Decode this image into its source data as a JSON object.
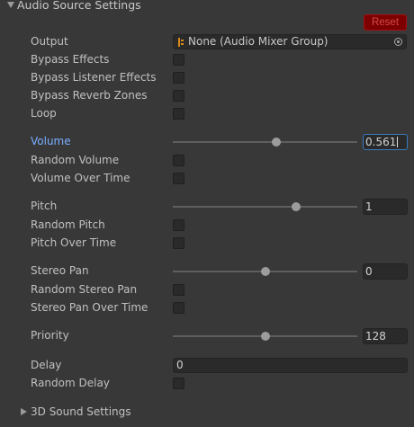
{
  "header": {
    "title": "Audio Source Settings",
    "reset_label": "Reset"
  },
  "output": {
    "label": "Output",
    "value": "None (Audio Mixer Group)"
  },
  "checkboxes_top": [
    {
      "label": "Bypass Effects",
      "checked": false
    },
    {
      "label": "Bypass Listener Effects",
      "checked": false
    },
    {
      "label": "Bypass Reverb Zones",
      "checked": false
    },
    {
      "label": "Loop",
      "checked": false
    }
  ],
  "volume": {
    "label": "Volume",
    "value": "0.561",
    "fraction": 0.561
  },
  "random_volume": {
    "label": "Random Volume",
    "checked": false
  },
  "volume_over_time": {
    "label": "Volume Over Time",
    "checked": false
  },
  "pitch": {
    "label": "Pitch",
    "value": "1",
    "fraction": 0.667
  },
  "random_pitch": {
    "label": "Random Pitch",
    "checked": false
  },
  "pitch_over_time": {
    "label": "Pitch Over Time",
    "checked": false
  },
  "stereo_pan": {
    "label": "Stereo Pan",
    "value": "0",
    "fraction": 0.5
  },
  "random_stereo_pan": {
    "label": "Random Stereo Pan",
    "checked": false
  },
  "stereo_pan_over_time": {
    "label": "Stereo Pan Over Time",
    "checked": false
  },
  "priority": {
    "label": "Priority",
    "value": "128",
    "fraction": 0.502
  },
  "delay": {
    "label": "Delay",
    "value": "0"
  },
  "random_delay": {
    "label": "Random Delay",
    "checked": false
  },
  "sound_3d": {
    "label": "3D Sound Settings"
  }
}
